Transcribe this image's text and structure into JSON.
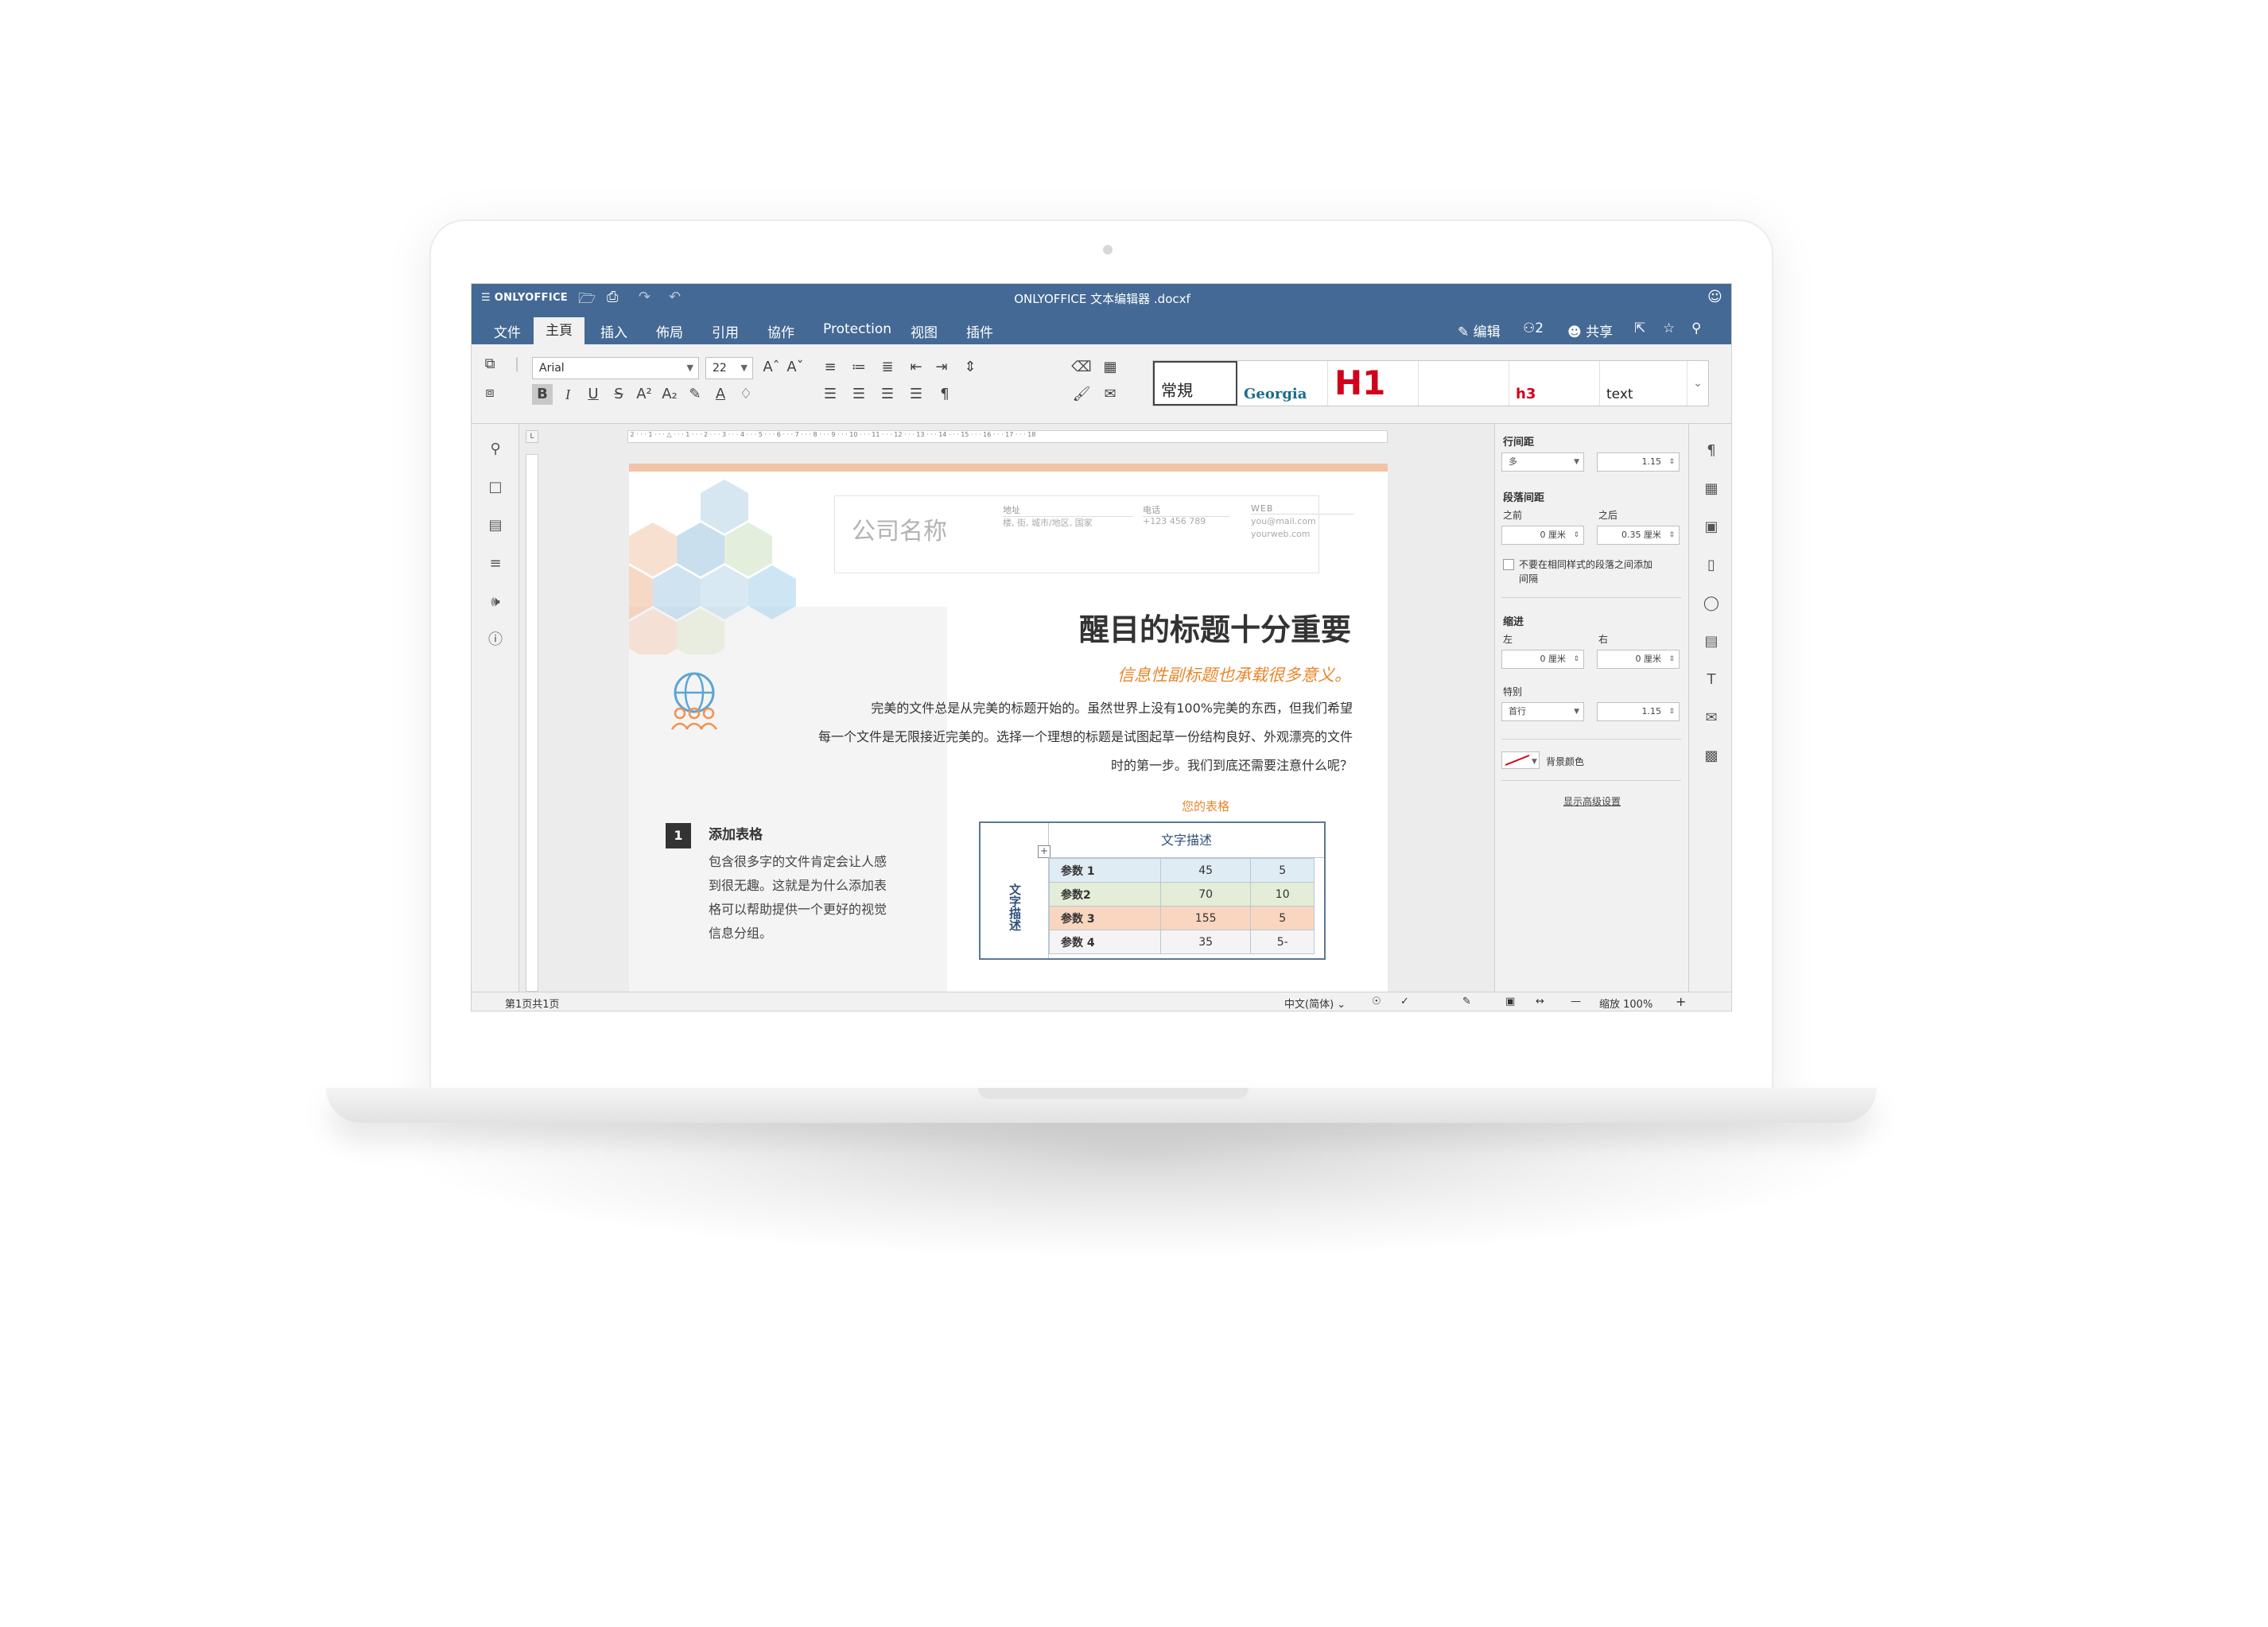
{
  "app": {
    "logo_text": "ONLYOFFICE",
    "window_title": "ONLYOFFICE 文本编辑器 .docxf"
  },
  "menu": {
    "items": [
      "文件",
      "主頁",
      "插入",
      "佈局",
      "引用",
      "協作",
      "Protection",
      "视图",
      "插件"
    ],
    "active": "主頁",
    "edit_label": "编辑",
    "users_count": "2",
    "share_label": "共享"
  },
  "toolbar": {
    "font_name": "Arial",
    "font_size": "22",
    "styles": [
      "常規",
      "Georgia",
      "H1",
      "",
      "h3",
      "text"
    ]
  },
  "document": {
    "company_name": "公司名称",
    "contact": {
      "address_label": "地址",
      "address_value": "楼, 街, 城市/地区, 国家",
      "phone_label": "电话",
      "phone_value": "+123 456 789",
      "web_label": "WEB",
      "email_value": "you@mail.com",
      "web_value": "yourweb.com"
    },
    "heading": "醒目的标题十分重要",
    "subheading": "信息性副标题也承载很多意义。",
    "body_lines": [
      "完美的文件总是从完美的标题开始的。虽然世界上没有100%完美的东西，但我们希望",
      "每一个文件是无限接近完美的。选择一个理想的标题是试图起草一份结构良好、外观漂亮的文件",
      "时的第一步。我们到底还需要注意什么呢？"
    ],
    "step_number": "1",
    "step_title": "添加表格",
    "step_lines": [
      "包含很多字的文件肯定会让人感",
      "到很无趣。这就是为什么添加表",
      "格可以帮助提供一个更好的视觉",
      "信息分组。"
    ],
    "table_caption": "您的表格",
    "table_header": "文字描述",
    "table_side_label": "文字描述",
    "table_rows": [
      {
        "label": "参数 1",
        "v1": "45",
        "v2": "5",
        "color": "#dfecf3"
      },
      {
        "label": "参数2",
        "v1": "70",
        "v2": "10",
        "color": "#e3edd8"
      },
      {
        "label": "参数 3",
        "v1": "155",
        "v2": "5",
        "color": "#f8d6bf"
      },
      {
        "label": "参数 4",
        "v1": "35",
        "v2": "5-",
        "color": "#f4f4f4"
      }
    ]
  },
  "right_panel": {
    "line_spacing_label": "行间距",
    "line_spacing_mode": "多",
    "line_spacing_value": "1.15",
    "para_spacing_label": "段落间距",
    "before_label": "之前",
    "after_label": "之后",
    "before_value": "0 厘米",
    "after_value": "0.35 厘米",
    "no_space_label_line1": "不要在相同样式的段落之间添加",
    "no_space_label_line2": "间隔",
    "indent_label": "缩进",
    "left_label": "左",
    "right_label": "右",
    "left_value": "0 厘米",
    "right_value": "0 厘米",
    "special_label": "特别",
    "special_mode": "首行",
    "special_value": "1.15",
    "bg_color_label": "背景颜色",
    "advanced_link": "显示高级设置"
  },
  "statusbar": {
    "page_info": "第1页共1页",
    "language": "中文(简体)",
    "zoom": "缩放 100%"
  },
  "colors": {
    "header_bg": "#446995",
    "accent_orange": "#e8862a",
    "h1_red": "#d0021b"
  }
}
